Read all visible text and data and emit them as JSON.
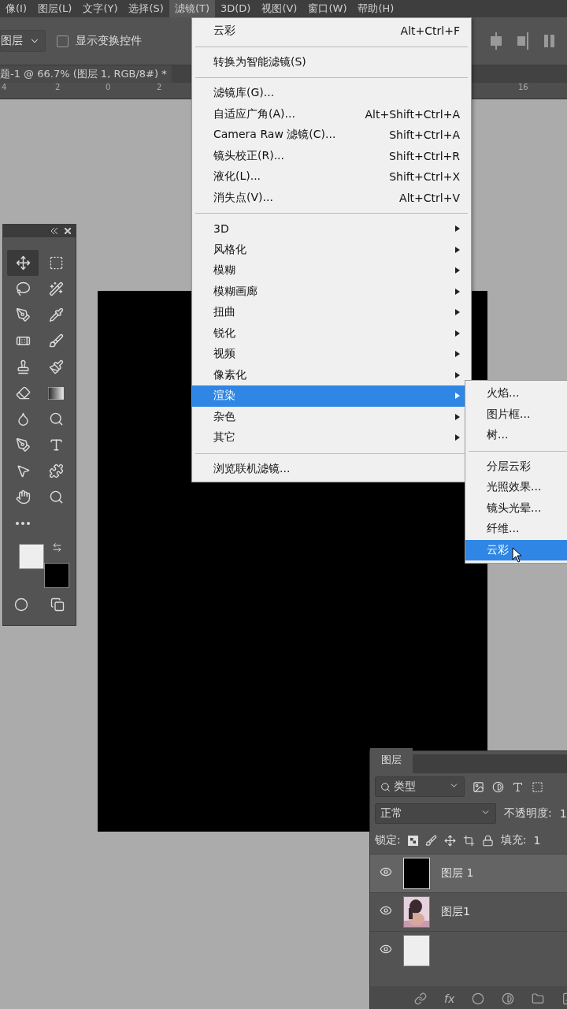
{
  "menu_bar": [
    {
      "label": "像(I)",
      "selected": false
    },
    {
      "label": "图层(L)",
      "selected": false
    },
    {
      "label": "文字(Y)",
      "selected": false
    },
    {
      "label": "选择(S)",
      "selected": false
    },
    {
      "label": "滤镜(T)",
      "selected": true
    },
    {
      "label": "3D(D)",
      "selected": false
    },
    {
      "label": "视图(V)",
      "selected": false
    },
    {
      "label": "窗口(W)",
      "selected": false
    },
    {
      "label": "帮助(H)",
      "selected": false
    }
  ],
  "options_bar": {
    "target": "图层",
    "show_transform": {
      "label": "显示变换控件",
      "checked": false
    }
  },
  "document_tab": {
    "title": "题-1 @ 66.7% (图层 1, RGB/8#) *"
  },
  "ruler": [
    "4",
    "2",
    "0",
    "2",
    "16"
  ],
  "filter_menu": [
    [
      {
        "label": "云彩",
        "shortcut": "Alt+Ctrl+F",
        "submenu": false,
        "selected": false
      }
    ],
    [
      {
        "label": "转换为智能滤镜(S)",
        "submenu": false,
        "selected": false
      }
    ],
    [
      {
        "label": "滤镜库(G)...",
        "submenu": false,
        "selected": false
      },
      {
        "label": "自适应广角(A)...",
        "shortcut": "Alt+Shift+Ctrl+A",
        "submenu": false,
        "selected": false
      },
      {
        "label": "Camera Raw 滤镜(C)...",
        "shortcut": "Shift+Ctrl+A",
        "submenu": false,
        "selected": false
      },
      {
        "label": "镜头校正(R)...",
        "shortcut": "Shift+Ctrl+R",
        "submenu": false,
        "selected": false
      },
      {
        "label": "液化(L)...",
        "shortcut": "Shift+Ctrl+X",
        "submenu": false,
        "selected": false
      },
      {
        "label": "消失点(V)...",
        "shortcut": "Alt+Ctrl+V",
        "submenu": false,
        "selected": false
      }
    ],
    [
      {
        "label": "3D",
        "submenu": true,
        "selected": false
      },
      {
        "label": "风格化",
        "submenu": true,
        "selected": false
      },
      {
        "label": "模糊",
        "submenu": true,
        "selected": false
      },
      {
        "label": "模糊画廊",
        "submenu": true,
        "selected": false
      },
      {
        "label": "扭曲",
        "submenu": true,
        "selected": false
      },
      {
        "label": "锐化",
        "submenu": true,
        "selected": false
      },
      {
        "label": "视频",
        "submenu": true,
        "selected": false
      },
      {
        "label": "像素化",
        "submenu": true,
        "selected": false
      },
      {
        "label": "渲染",
        "submenu": true,
        "selected": true
      },
      {
        "label": "杂色",
        "submenu": true,
        "selected": false
      },
      {
        "label": "其它",
        "submenu": true,
        "selected": false
      }
    ],
    [
      {
        "label": "浏览联机滤镜...",
        "submenu": false,
        "selected": false
      }
    ]
  ],
  "render_submenu": [
    [
      {
        "label": "火焰...",
        "selected": false
      },
      {
        "label": "图片框...",
        "selected": false
      },
      {
        "label": "树...",
        "selected": false
      }
    ],
    [
      {
        "label": "分层云彩",
        "selected": false
      },
      {
        "label": "光照效果...",
        "selected": false
      },
      {
        "label": "镜头光晕...",
        "selected": false
      },
      {
        "label": "纤维...",
        "selected": false
      },
      {
        "label": "云彩",
        "selected": true
      }
    ]
  ],
  "layers_panel": {
    "tab": "图层",
    "filter": "类型",
    "blend_mode": "正常",
    "opacity_label": "不透明度:",
    "opacity_value": "1",
    "lock_label": "锁定:",
    "fill_label": "填充:",
    "fill_value": "1",
    "layers": [
      {
        "name": "图层 1",
        "kind": "dark",
        "visible": true,
        "selected": true
      },
      {
        "name": "图层1",
        "kind": "picture",
        "visible": true,
        "selected": false
      },
      {
        "kind": "blank",
        "visible": true,
        "selected": false
      }
    ],
    "footer": {
      "fx": "fx"
    }
  }
}
